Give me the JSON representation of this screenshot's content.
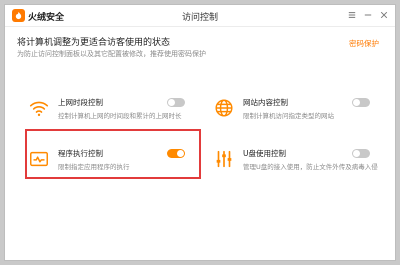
{
  "app": {
    "brand": "火绒安全",
    "window_title": "访问控制",
    "brand_color": "#ff7a00"
  },
  "window_buttons": [
    {
      "icon": "menu-icon"
    },
    {
      "icon": "minimize-icon"
    },
    {
      "icon": "close-icon"
    }
  ],
  "header": {
    "headline": "将计算机调整为更适合访客使用的状态",
    "subline": "为防止访问控制面板以及其它配置被修改，推荐使用密码保护",
    "password_link": "密码保护"
  },
  "features": [
    {
      "id": "online-time",
      "icon": "wifi-icon",
      "name": "上网时段控制",
      "desc": "控制计算机上网的时间段和累计的上网时长",
      "enabled": false
    },
    {
      "id": "web-content",
      "icon": "globe-icon",
      "name": "网站内容控制",
      "desc": "限制计算机访问指定类型的网站",
      "enabled": false
    },
    {
      "id": "program-exec",
      "icon": "program-window-icon",
      "name": "程序执行控制",
      "desc": "限制指定应用程序的执行",
      "enabled": true
    },
    {
      "id": "usb-control",
      "icon": "sliders-icon",
      "name": "U盘使用控制",
      "desc": "管理U盘的接入使用，防止文件外传及病毒入侵",
      "enabled": false
    }
  ],
  "colors": {
    "toggle_on": "#ff8a00",
    "toggle_off": "#c8c8c8",
    "highlight": "#e23b3b"
  }
}
